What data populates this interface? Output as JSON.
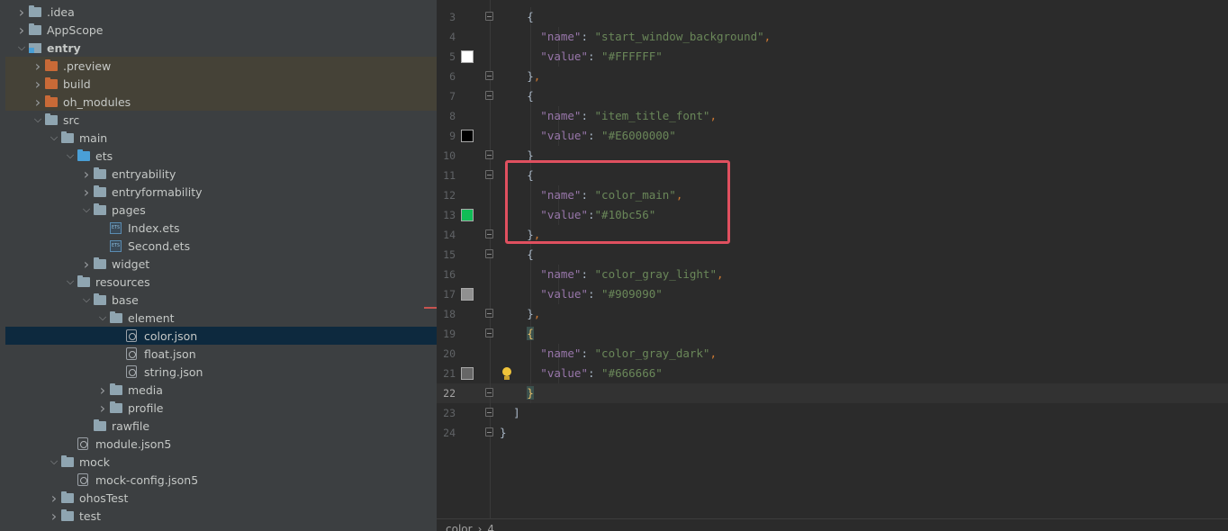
{
  "tree": [
    {
      "label": ".idea",
      "depth": 1,
      "expanded": false,
      "kind": "folder"
    },
    {
      "label": "AppScope",
      "depth": 1,
      "expanded": false,
      "kind": "folder"
    },
    {
      "label": "entry",
      "depth": 1,
      "expanded": true,
      "kind": "module",
      "bold": true
    },
    {
      "label": ".preview",
      "depth": 2,
      "expanded": false,
      "kind": "folder-orange",
      "highlight": true
    },
    {
      "label": "build",
      "depth": 2,
      "expanded": false,
      "kind": "folder-orange",
      "highlight": true
    },
    {
      "label": "oh_modules",
      "depth": 2,
      "expanded": false,
      "kind": "folder-orange",
      "highlight": true
    },
    {
      "label": "src",
      "depth": 2,
      "expanded": true,
      "kind": "folder"
    },
    {
      "label": "main",
      "depth": 3,
      "expanded": true,
      "kind": "folder"
    },
    {
      "label": "ets",
      "depth": 4,
      "expanded": true,
      "kind": "folder-blue"
    },
    {
      "label": "entryability",
      "depth": 5,
      "expanded": false,
      "kind": "folder"
    },
    {
      "label": "entryformability",
      "depth": 5,
      "expanded": false,
      "kind": "folder"
    },
    {
      "label": "pages",
      "depth": 5,
      "expanded": true,
      "kind": "folder"
    },
    {
      "label": "Index.ets",
      "depth": 6,
      "kind": "ets"
    },
    {
      "label": "Second.ets",
      "depth": 6,
      "kind": "ets"
    },
    {
      "label": "widget",
      "depth": 5,
      "expanded": false,
      "kind": "folder"
    },
    {
      "label": "resources",
      "depth": 4,
      "expanded": true,
      "kind": "folder"
    },
    {
      "label": "base",
      "depth": 5,
      "expanded": true,
      "kind": "folder"
    },
    {
      "label": "element",
      "depth": 6,
      "expanded": true,
      "kind": "folder"
    },
    {
      "label": "color.json",
      "depth": 7,
      "kind": "json",
      "selected": true
    },
    {
      "label": "float.json",
      "depth": 7,
      "kind": "json"
    },
    {
      "label": "string.json",
      "depth": 7,
      "kind": "json"
    },
    {
      "label": "media",
      "depth": 6,
      "expanded": false,
      "kind": "folder"
    },
    {
      "label": "profile",
      "depth": 6,
      "expanded": false,
      "kind": "folder"
    },
    {
      "label": "rawfile",
      "depth": 5,
      "kind": "folder"
    },
    {
      "label": "module.json5",
      "depth": 4,
      "kind": "json"
    },
    {
      "label": "mock",
      "depth": 3,
      "expanded": true,
      "kind": "folder"
    },
    {
      "label": "mock-config.json5",
      "depth": 4,
      "kind": "json"
    },
    {
      "label": "ohosTest",
      "depth": 3,
      "expanded": false,
      "kind": "folder"
    },
    {
      "label": "test",
      "depth": 3,
      "expanded": false,
      "kind": "folder"
    }
  ],
  "editor": {
    "current_line": 22,
    "lines": [
      {
        "n": 3,
        "indent": 2,
        "tokens": [
          [
            "b",
            "{"
          ]
        ],
        "fold": true
      },
      {
        "n": 4,
        "indent": 3,
        "tokens": [
          [
            "k",
            "\"name\""
          ],
          [
            "b",
            ": "
          ],
          [
            "s",
            "\"start_window_background\""
          ],
          [
            "p",
            ","
          ]
        ]
      },
      {
        "n": 5,
        "indent": 3,
        "tokens": [
          [
            "k",
            "\"value\""
          ],
          [
            "b",
            ": "
          ],
          [
            "s",
            "\"#FFFFFF\""
          ]
        ],
        "swatch": "#FFFFFF"
      },
      {
        "n": 6,
        "indent": 2,
        "tokens": [
          [
            "b",
            "}"
          ],
          [
            "p",
            ","
          ]
        ],
        "fold": true
      },
      {
        "n": 7,
        "indent": 2,
        "tokens": [
          [
            "b",
            "{"
          ]
        ],
        "fold": true
      },
      {
        "n": 8,
        "indent": 3,
        "tokens": [
          [
            "k",
            "\"name\""
          ],
          [
            "b",
            ": "
          ],
          [
            "s",
            "\"item_title_font\""
          ],
          [
            "p",
            ","
          ]
        ]
      },
      {
        "n": 9,
        "indent": 3,
        "tokens": [
          [
            "k",
            "\"value\""
          ],
          [
            "b",
            ": "
          ],
          [
            "s",
            "\"#E6000000\""
          ]
        ],
        "swatch": "#000000"
      },
      {
        "n": 10,
        "indent": 2,
        "tokens": [
          [
            "b",
            "}"
          ]
        ],
        "fold": true
      },
      {
        "n": 11,
        "indent": 2,
        "tokens": [
          [
            "b",
            "{"
          ]
        ],
        "fold": true
      },
      {
        "n": 12,
        "indent": 3,
        "tokens": [
          [
            "k",
            "\"name\""
          ],
          [
            "b",
            ": "
          ],
          [
            "s",
            "\"color_main\""
          ],
          [
            "p",
            ","
          ]
        ]
      },
      {
        "n": 13,
        "indent": 3,
        "tokens": [
          [
            "k",
            "\"value\""
          ],
          [
            "b",
            ":"
          ],
          [
            "s",
            "\"#10bc56\""
          ]
        ],
        "swatch": "#10bc56"
      },
      {
        "n": 14,
        "indent": 2,
        "tokens": [
          [
            "b",
            "}"
          ],
          [
            "p",
            ","
          ]
        ],
        "fold": true
      },
      {
        "n": 15,
        "indent": 2,
        "tokens": [
          [
            "b",
            "{"
          ]
        ],
        "fold": true
      },
      {
        "n": 16,
        "indent": 3,
        "tokens": [
          [
            "k",
            "\"name\""
          ],
          [
            "b",
            ": "
          ],
          [
            "s",
            "\"color_gray_light\""
          ],
          [
            "p",
            ","
          ]
        ]
      },
      {
        "n": 17,
        "indent": 3,
        "tokens": [
          [
            "k",
            "\"value\""
          ],
          [
            "b",
            ": "
          ],
          [
            "s",
            "\"#909090\""
          ]
        ],
        "swatch": "#909090"
      },
      {
        "n": 18,
        "indent": 2,
        "tokens": [
          [
            "b",
            "}"
          ],
          [
            "p",
            ","
          ]
        ],
        "fold": true
      },
      {
        "n": 19,
        "indent": 2,
        "tokens": [
          [
            "bm",
            "{"
          ]
        ],
        "fold": true
      },
      {
        "n": 20,
        "indent": 3,
        "tokens": [
          [
            "k",
            "\"name\""
          ],
          [
            "b",
            ": "
          ],
          [
            "s",
            "\"color_gray_dark\""
          ],
          [
            "p",
            ","
          ]
        ]
      },
      {
        "n": 21,
        "indent": 3,
        "tokens": [
          [
            "k",
            "\"value\""
          ],
          [
            "b",
            ": "
          ],
          [
            "s",
            "\"#666666\""
          ]
        ],
        "swatch": "#666666",
        "bulb": true
      },
      {
        "n": 22,
        "indent": 2,
        "tokens": [
          [
            "bm",
            "}"
          ]
        ],
        "fold": true
      },
      {
        "n": 23,
        "indent": 1,
        "tokens": [
          [
            "b",
            "]"
          ]
        ],
        "fold": true
      },
      {
        "n": 24,
        "indent": 0,
        "tokens": [
          [
            "b",
            "}"
          ]
        ],
        "fold": true
      }
    ]
  },
  "breadcrumb": [
    "color",
    "4"
  ]
}
